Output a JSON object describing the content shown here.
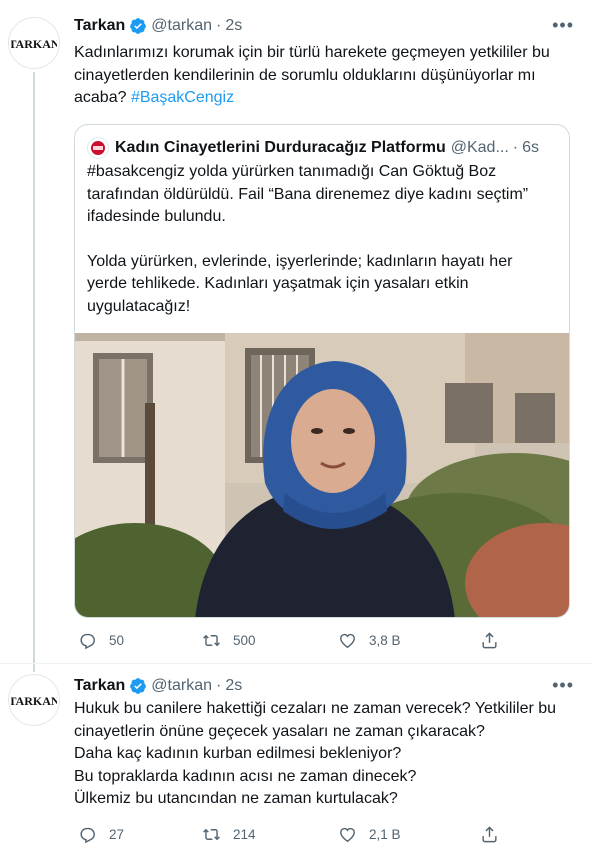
{
  "tweet1": {
    "avatar_text": "TARKAN",
    "author_name": "Tarkan",
    "author_handle": "@tarkan",
    "dot": "·",
    "time": "2s",
    "text_main": "Kadınlarımızı korumak için bir türlü harekete geçmeyen yetkililer bu cinayetlerden kendilerinin de sorumlu olduklarını düşünüyorlar mı acaba? ",
    "hashtag": "#BaşakCengiz",
    "quote": {
      "author_name": "Kadın Cinayetlerini Durduracağız Platformu",
      "author_handle": "@Kad...",
      "dot": "·",
      "time": "6s",
      "paragraph1": "#basakcengiz yolda yürürken tanımadığı Can Göktuğ Boz tarafından öldürüldü. Fail “Bana direnemez diye kadını seçtim” ifadesinde bulundu.",
      "paragraph2": "Yolda yürürken, evlerinde, işyerlerinde; kadınların hayatı her yerde tehlikede. Kadınları yaşatmak için yasaları etkin uygulatacağız!"
    },
    "actions": {
      "reply_count": "50",
      "retweet_count": "500",
      "like_count": "3,8 B"
    }
  },
  "tweet2": {
    "avatar_text": "TARKAN",
    "author_name": "Tarkan",
    "author_handle": "@tarkan",
    "dot": "·",
    "time": "2s",
    "lines": [
      "Hukuk bu canilere hakettiği cezaları ne zaman verecek? Yetkililer bu cinayetlerin önüne geçecek yasaları ne zaman çıkaracak?",
      "Daha kaç kadının kurban edilmesi bekleniyor?",
      "Bu topraklarda kadının acısı ne zaman dinecek?",
      "Ülkemiz bu utancından ne zaman kurtulacak?"
    ],
    "actions": {
      "reply_count": "27",
      "retweet_count": "214",
      "like_count": "2,1 B"
    }
  },
  "icons": {
    "verified": "verified-badge-icon",
    "more": "more-icon",
    "reply": "reply-icon",
    "retweet": "retweet-icon",
    "like": "heart-icon",
    "share": "share-icon"
  },
  "colors": {
    "link": "#1d9bf0",
    "muted": "#536471",
    "text": "#0f1419",
    "verified": "#1d9bf0"
  }
}
